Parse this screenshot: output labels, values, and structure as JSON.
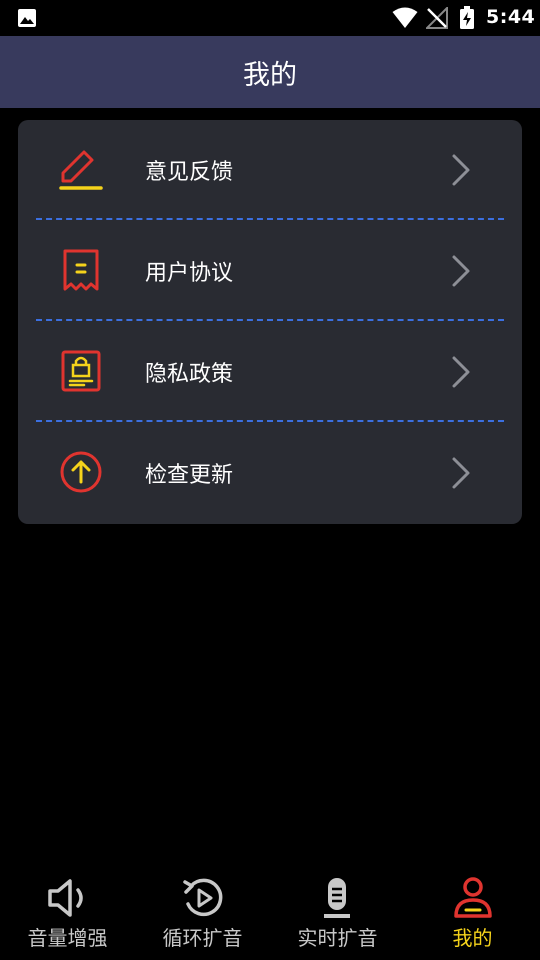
{
  "status_bar": {
    "time": "5:44"
  },
  "app_bar": {
    "title": "我的"
  },
  "menu": [
    {
      "label": "意见反馈",
      "icon": "edit-pencil-icon"
    },
    {
      "label": "用户协议",
      "icon": "document-receipt-icon"
    },
    {
      "label": "隐私政策",
      "icon": "privacy-lock-icon"
    },
    {
      "label": "检查更新",
      "icon": "upgrade-arrow-icon"
    }
  ],
  "bottom_nav": [
    {
      "label": "音量增强",
      "icon": "speaker-volume-icon",
      "active": false
    },
    {
      "label": "循环扩音",
      "icon": "loop-play-icon",
      "active": false
    },
    {
      "label": "实时扩音",
      "icon": "microphone-icon",
      "active": false
    },
    {
      "label": "我的",
      "icon": "user-profile-icon",
      "active": true
    }
  ],
  "colors": {
    "app_bar": "#383a5d",
    "card": "#292b32",
    "accent_red": "#e0342f",
    "accent_yellow": "#f5d31b",
    "divider": "#3b6fe0"
  }
}
